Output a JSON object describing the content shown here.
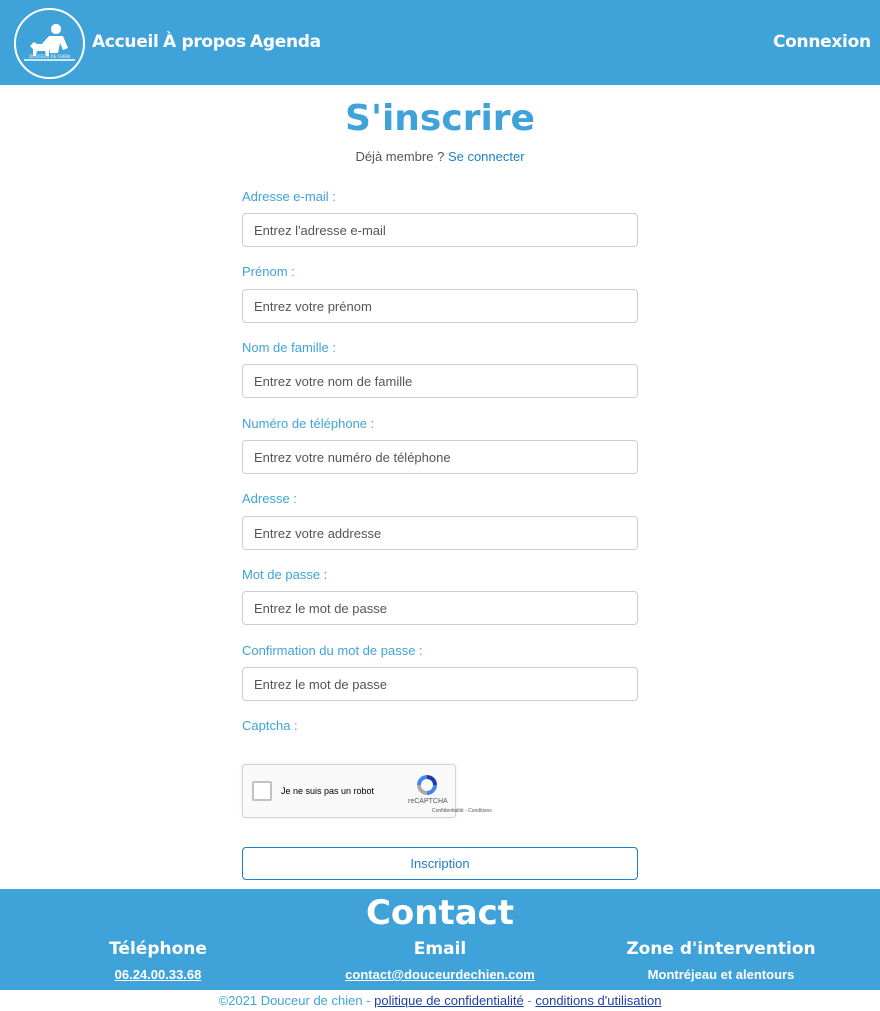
{
  "nav": {
    "logo_text": "DOUCEUR DE CHIEN",
    "accueil": "Accueil",
    "apropos": "À propos",
    "agenda": "Agenda",
    "connexion": "Connexion"
  },
  "main": {
    "title": "S'inscrire",
    "member_text": "Déjà membre ?",
    "member_link": "Se connecter",
    "fields": {
      "email": {
        "label": "Adresse e-mail :",
        "placeholder": "Entrez l'adresse e-mail"
      },
      "prenom": {
        "label": "Prénom :",
        "placeholder": "Entrez votre prénom"
      },
      "nom": {
        "label": "Nom de famille :",
        "placeholder": "Entrez votre nom de famille"
      },
      "telephone": {
        "label": "Numéro de téléphone :",
        "placeholder": "Entrez votre numéro de téléphone"
      },
      "adresse": {
        "label": "Adresse :",
        "placeholder": "Entrez votre addresse"
      },
      "password": {
        "label": "Mot de passe :",
        "placeholder": "Entrez le mot de passe"
      },
      "password_confirm": {
        "label": "Confirmation du mot de passe :",
        "placeholder": "Entrez le mot de passe"
      }
    },
    "captcha": {
      "label": "Captcha :",
      "checkbox_text": "Je ne suis pas un robot",
      "brand": "reCAPTCHA",
      "terms": "Confidentialité - Conditions"
    },
    "submit_label": "Inscription"
  },
  "footer": {
    "title": "Contact",
    "telephone": {
      "heading": "Téléphone",
      "value": "06.24.00.33.68"
    },
    "email": {
      "heading": "Email",
      "value": "contact@douceurdechien.com"
    },
    "zone": {
      "heading": "Zone d'intervention",
      "value": "Montréjeau et alentours"
    },
    "copyright": "©2021 Douceur de chien -",
    "separator": "-",
    "privacy_link": "politique de confidentialité",
    "terms_link": "conditions d'utilisation"
  },
  "colors": {
    "brand": "#3fa3d9",
    "link": "#1f7fc4"
  }
}
